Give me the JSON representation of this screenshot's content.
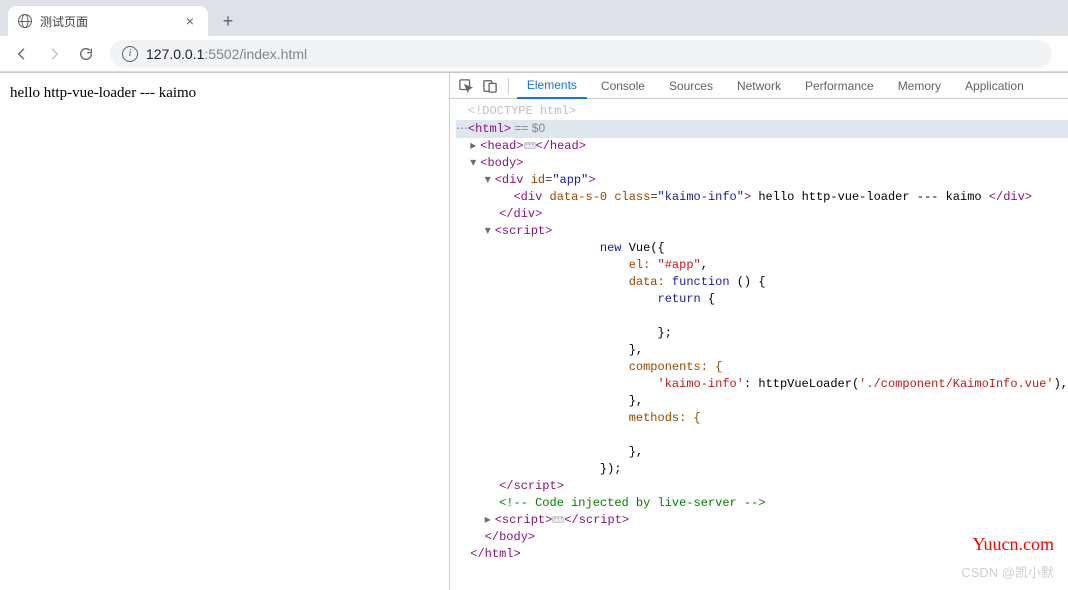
{
  "chrome": {
    "tab_title": "测试页面",
    "url_host": "127.0.0.1",
    "url_port": ":5502",
    "url_path": "/index.html"
  },
  "page": {
    "body_text": "hello http-vue-loader --- kaimo"
  },
  "devtools": {
    "tabs": [
      "Elements",
      "Console",
      "Sources",
      "Network",
      "Performance",
      "Memory",
      "Application"
    ],
    "active_tab": "Elements",
    "dom": {
      "doctype": "<!DOCTYPE html>",
      "sel_suffix": " == $0",
      "live_server_comment": "<!-- Code injected by live-server -->",
      "div_app_id": "app",
      "div_inner_attr1": "data-s-0",
      "div_inner_cls": "kaimo-info",
      "div_inner_text": " hello http-vue-loader --- kaimo ",
      "script_text": {
        "l1": "new Vue({",
        "l2": "el: ",
        "l2s": "\"#app\"",
        "l3": "data: ",
        "l3f": "function",
        "l3r": " () {",
        "l4": "return",
        "l4r": " {",
        "l5": "};",
        "l6": "},",
        "l7": "components: {",
        "l8k": "'kaimo-info'",
        "l8m": ": httpVueLoader(",
        "l8s": "'./component/KaimoInfo.vue'",
        "l8e": "),",
        "l9": "},",
        "l10": "methods: {",
        "l11": "},",
        "l12": "});"
      }
    }
  },
  "watermarks": {
    "w1": "Yuucn.com",
    "w2": "CSDN @凯小默"
  }
}
